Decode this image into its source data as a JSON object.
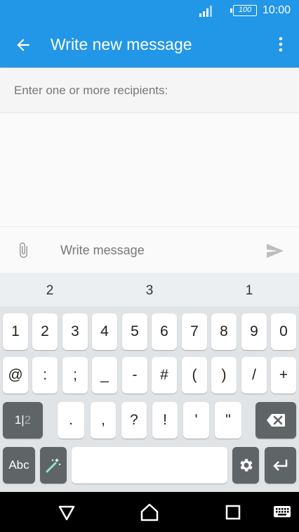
{
  "status_bar": {
    "battery": "100",
    "time": "10:00"
  },
  "app_bar": {
    "title": "Write new message"
  },
  "recipients": {
    "placeholder": "Enter one or more recipients:"
  },
  "compose": {
    "placeholder": "Write message"
  },
  "suggestions": [
    "2",
    "3",
    "1"
  ],
  "keyboard": {
    "row1": [
      "1",
      "2",
      "3",
      "4",
      "5",
      "6",
      "7",
      "8",
      "9",
      "0"
    ],
    "row2": [
      "@",
      ":",
      ";",
      "_",
      "-",
      "#",
      "(",
      ")",
      "/",
      "+"
    ],
    "row3": [
      ".",
      ",",
      "?",
      "!",
      "'",
      "\""
    ],
    "mode_key": {
      "active": "1",
      "sep": "|",
      "inactive": "2"
    },
    "abc_label": "Abc"
  },
  "colors": {
    "accent": "#2296e7",
    "keyboard_bg": "#e1e4e6",
    "dark_key": "#5f6466"
  },
  "icons": {
    "back": "arrow-left-icon",
    "more": "more-vert-icon",
    "attach": "paperclip-icon",
    "send": "send-icon",
    "backspace": "backspace-icon",
    "emoji_wand": "magic-wand-icon",
    "settings": "gear-icon",
    "enter": "enter-icon",
    "nav_back": "triangle-back-icon",
    "nav_home": "home-icon",
    "nav_recent": "square-recent-icon",
    "nav_keyboard": "keyboard-icon"
  }
}
